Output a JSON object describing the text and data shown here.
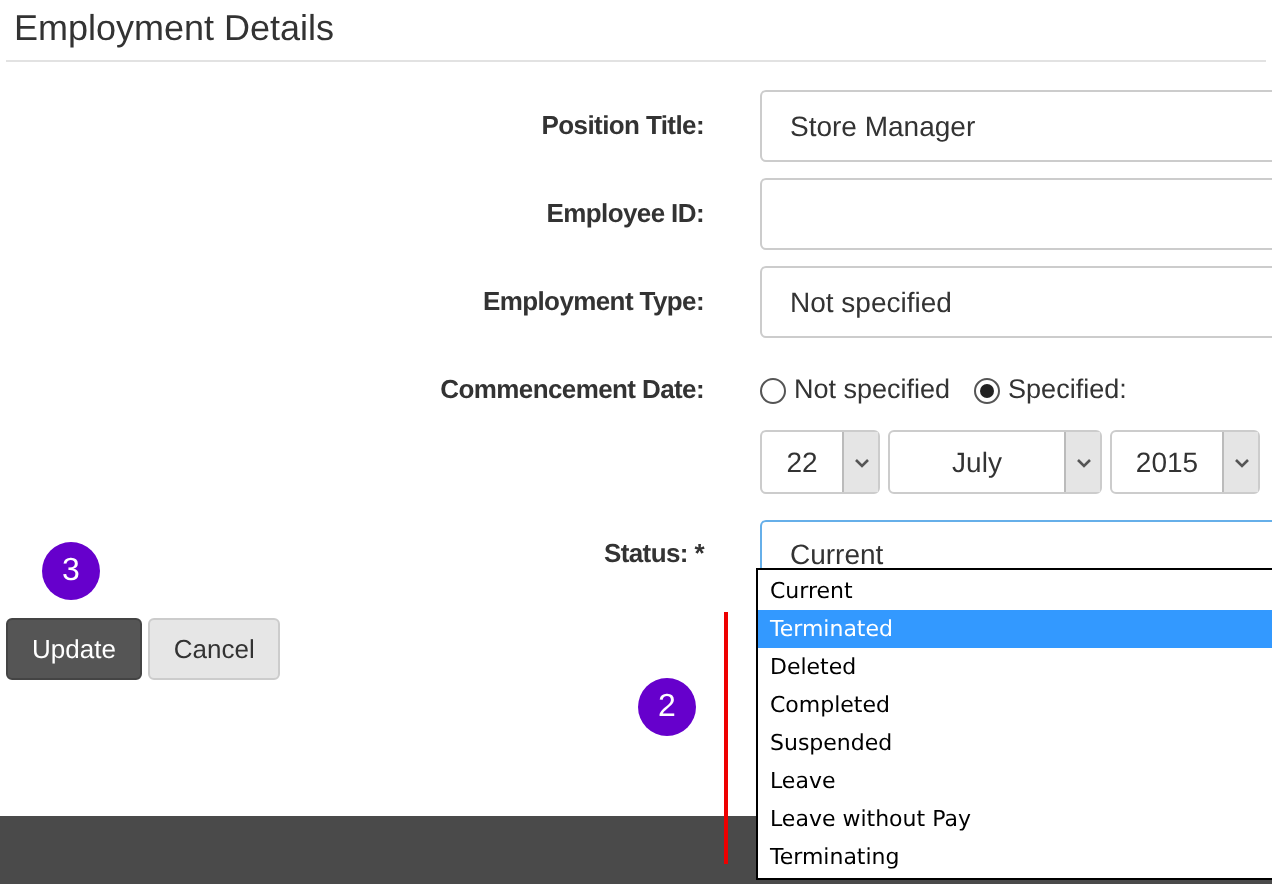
{
  "title": "Employment Details",
  "fields": [
    {
      "label": "Position Title:",
      "value": "Store Manager"
    },
    {
      "label": "Employee ID:"
    },
    {
      "label": "Employment Type:",
      "value": "Not specified"
    }
  ],
  "commencement": {
    "label": "Commencement Date:",
    "options": [
      {
        "label": "Not specified",
        "selected": false
      },
      {
        "label": "Specified:",
        "selected": true
      }
    ],
    "day": "22",
    "month": "July",
    "year": "2015"
  },
  "status": {
    "label": "Status: *",
    "value": "Current",
    "expanded": true,
    "options": [
      {
        "label": "Current",
        "highlighted": false
      },
      {
        "label": "Terminated",
        "highlighted": true
      },
      {
        "label": "Deleted",
        "highlighted": false
      },
      {
        "label": "Completed",
        "highlighted": false
      },
      {
        "label": "Suspended",
        "highlighted": false
      },
      {
        "label": "Leave",
        "highlighted": false
      },
      {
        "label": "Leave without Pay",
        "highlighted": false
      },
      {
        "label": "Terminating",
        "highlighted": false
      }
    ]
  },
  "buttons": [
    {
      "label": "Update",
      "kind": "primary"
    },
    {
      "label": "Cancel",
      "kind": "secondary"
    }
  ],
  "callouts": [
    "3",
    "2"
  ]
}
